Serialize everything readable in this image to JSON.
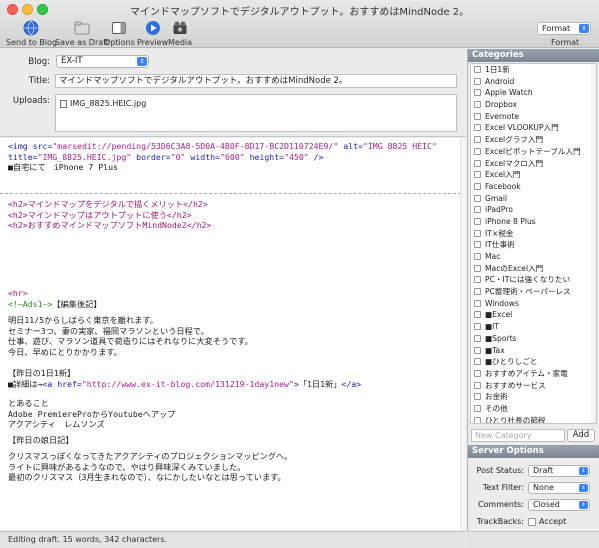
{
  "window": {
    "title": "マインドマップソフトでデジタルアウトプット。おすすめはMindNode 2。"
  },
  "toolbar": {
    "send_to_blog": "Send to Blog",
    "save_as_draft": "Save as Draft",
    "options": "Options",
    "preview": "Preview",
    "media": "Media",
    "format_value": "Format",
    "format_label": "Format"
  },
  "header": {
    "blog_label": "Blog:",
    "blog_value": "EX-IT",
    "title_label": "Title:",
    "title_value": "マインドマップソフトでデジタルアウトプット。おすすめはMindNode 2。",
    "uploads_label": "Uploads:",
    "upload_file": "IMG_8825.HEIC.jpg"
  },
  "editor": {
    "img_open": "<img ",
    "img_src_attr": "src=",
    "img_src_val": "\"marsedit://pending/53D6C3A8-5D0A-4B0F-8D17-BC2D110724E9/\"",
    "img_alt_attr": " alt=",
    "img_alt_val": "\"IMG 8825 HEIC\"",
    "img_title_attr": "title=",
    "img_title_val": "\"IMG_8825.HEIC.jpg\"",
    "img_border_attr": " border=",
    "img_border_val": "\"0\"",
    "img_width_attr": " width=",
    "img_width_val": "\"600\"",
    "img_height_attr": " height=",
    "img_height_val": "\"450\"",
    "img_close": " />",
    "caption": "■自宅にて　iPhone 7 Plus",
    "h2_1": "<h2>マインドマップをデジタルで描くメリット</h2>",
    "h2_2": "<h2>マインドマップはアウトプットに使う</h2>",
    "h2_3": "<h2>おすすめマインドマップソフトMindNode2</h2>",
    "hr": "<hr>",
    "comment": "<!—Ads1—>",
    "edit_note": "【編集後記】",
    "p1": "明日11/5からしばらく東京を離れます。",
    "p2": "セミナー3つ、妻の実家、福岡マラソンという日程で。",
    "p3": "仕事、遊び、マラソン道具で荷造りにはそれなりに大変そうです。",
    "p4": "今日、早めにとりかかります。",
    "prev_day": "【昨日の1日1新】",
    "detail_prefix": "■詳細は→",
    "a_open": "<a ",
    "a_href_attr": "href=",
    "a_href_val": "\"http://www.ex-it-blog.com/131219-1day1new\"",
    "a_close_open": ">",
    "a_text": "「1日1新」",
    "a_end": "</a>",
    "t1": "とあること",
    "t2": "Adobe PremiereProからYoutubeへアップ",
    "t3": "アクアシティ　レムソンズ",
    "prev_daughter": "【昨日の娘日記】",
    "d1": "クリスマスっぽくなってきたアクアシティのプロジェクションマッピングへ。",
    "d2": "ライトに興味があるようなので、やはり興味深くみていました。",
    "d3": "最初のクリスマス（3月生まれなので）、なにかしたいなとは思っています。"
  },
  "status": {
    "text": "Editing draft. 15 words, 342 characters."
  },
  "categories": {
    "header": "Categories",
    "items": [
      "1日1新",
      "Android",
      "Apple Watch",
      "Dropbox",
      "Evernote",
      "Excel VLOOKUP入門",
      "Excelグラフ入門",
      "Excelピボットテーブル入門",
      "Excelマクロ入門",
      "Excel入門",
      "Facebook",
      "Gmail",
      "iPadPro",
      "iPhone 8 Plus",
      "IT×税金",
      "IT仕事術",
      "Mac",
      "MacのExcel入門",
      "PC・ITには強くなりたい",
      "PC整理術・ペーパーレス",
      "Windows",
      "■Excel",
      "■IT",
      "■Sports",
      "■Tax",
      "■ひとりしごと",
      "おすすめアイテム・家電",
      "おすすめサービス",
      "お金術",
      "その他",
      "ひとり社長の節税"
    ],
    "new_placeholder": "New Category",
    "add_label": "Add"
  },
  "server": {
    "header": "Server Options",
    "post_status_label": "Post Status:",
    "post_status_value": "Draft",
    "text_filter_label": "Text Filter:",
    "text_filter_value": "None",
    "comments_label": "Comments:",
    "comments_value": "Closed",
    "trackbacks_label": "TrackBacks:",
    "trackbacks_value": "Accept"
  },
  "colors": {
    "accent": "#3a82f7",
    "tag": "#1d1dae",
    "string": "#a3228d",
    "comment": "#2d8a2d"
  }
}
